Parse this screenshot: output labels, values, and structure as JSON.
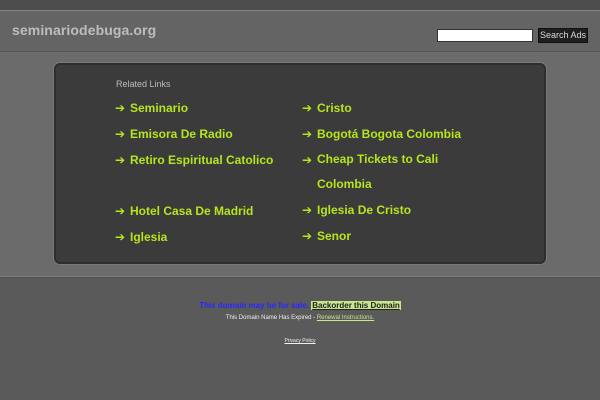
{
  "header": {
    "site_name": "seminariodebuga.org",
    "search_placeholder": "",
    "search_button": "Search Ads"
  },
  "links_panel": {
    "heading": "Related Links",
    "left": [
      {
        "text": "Seminario"
      },
      {
        "text": "Emisora De Radio"
      },
      {
        "text": "Retiro Espiritual Catolico"
      },
      {
        "text": "Hotel Casa De Madrid"
      },
      {
        "text": "Iglesia"
      }
    ],
    "right": [
      {
        "text": "Cristo"
      },
      {
        "text": "Bogotá Bogota Colombia"
      },
      {
        "text": "Cheap Tickets to Cali Colombia"
      },
      {
        "text": "Iglesia De Cristo"
      },
      {
        "text": "Senor"
      }
    ],
    "arrow_glyph": "➔",
    "link_color": "#b5e61d"
  },
  "footer": {
    "sale_text": "This domain may be for sale.",
    "backorder_text": "Backorder this Domain",
    "expired_text": "This Domain Name Has Expired - ",
    "renewal_text": "Renewal Instructions.",
    "privacy_text": "Privacy Policy"
  }
}
